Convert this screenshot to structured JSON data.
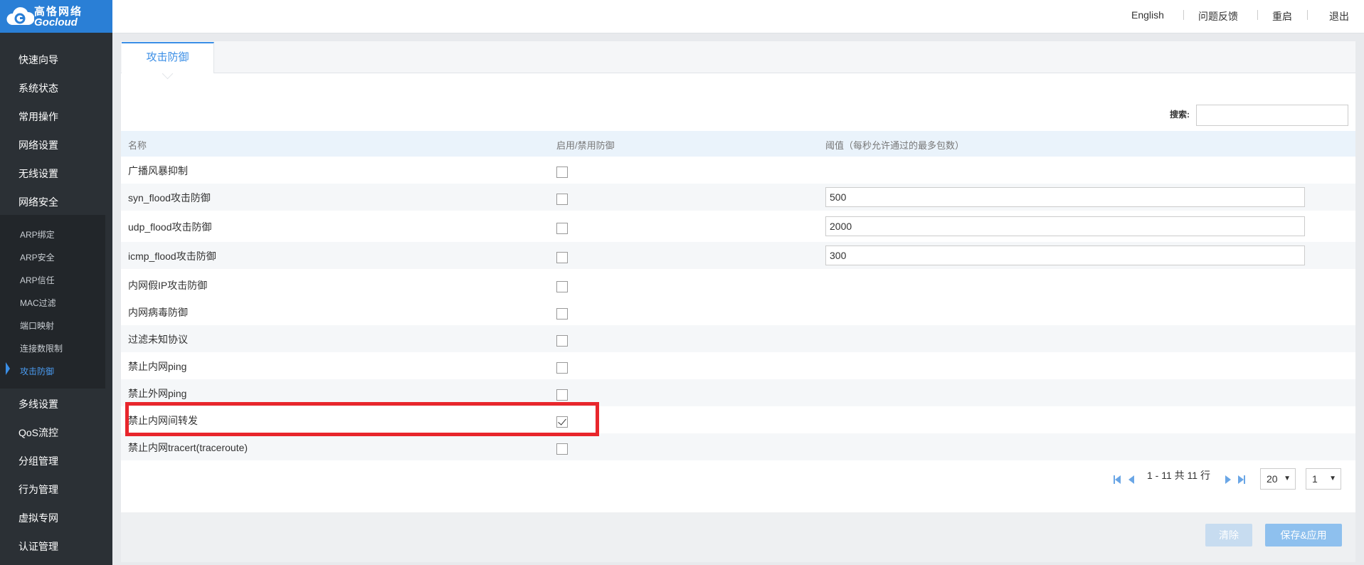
{
  "brand": {
    "cn": "高恪网络",
    "en": "Gocloud"
  },
  "top_links": [
    "English",
    "问题反馈",
    "重启",
    "退出"
  ],
  "nav_main": [
    "快速向导",
    "系统状态",
    "常用操作",
    "网络设置",
    "无线设置",
    "网络安全"
  ],
  "nav_sub": [
    "ARP绑定",
    "ARP安全",
    "ARP信任",
    "MAC过滤",
    "端口映射",
    "连接数限制",
    "攻击防御"
  ],
  "nav_after": [
    "多线设置",
    "QoS流控",
    "分组管理",
    "行为管理",
    "虚拟专网",
    "认证管理"
  ],
  "tab_label": "攻击防御",
  "search": {
    "label": "搜索:",
    "value": ""
  },
  "table": {
    "headers": [
      "名称",
      "启用/禁用防御",
      "阈值（每秒允许通过的最多包数）"
    ],
    "rows": [
      {
        "name": "广播风暴抑制",
        "checked": false,
        "threshold": null
      },
      {
        "name": "syn_flood攻击防御",
        "checked": false,
        "threshold": "500"
      },
      {
        "name": "udp_flood攻击防御",
        "checked": false,
        "threshold": "2000"
      },
      {
        "name": "icmp_flood攻击防御",
        "checked": false,
        "threshold": "300"
      },
      {
        "name": "内网假IP攻击防御",
        "checked": false,
        "threshold": null
      },
      {
        "name": "内网病毒防御",
        "checked": false,
        "threshold": null
      },
      {
        "name": "过滤未知协议",
        "checked": false,
        "threshold": null
      },
      {
        "name": "禁止内网ping",
        "checked": false,
        "threshold": null
      },
      {
        "name": "禁止外网ping",
        "checked": false,
        "threshold": null
      },
      {
        "name": "禁止内网间转发",
        "checked": true,
        "threshold": null
      },
      {
        "name": "禁止内网tracert(traceroute)",
        "checked": false,
        "threshold": null
      }
    ]
  },
  "pagination": {
    "range": "1 - 11 共 11 行",
    "page_size": "20",
    "page": "1"
  },
  "buttons": {
    "clear": "清除",
    "save": "保存&应用"
  }
}
